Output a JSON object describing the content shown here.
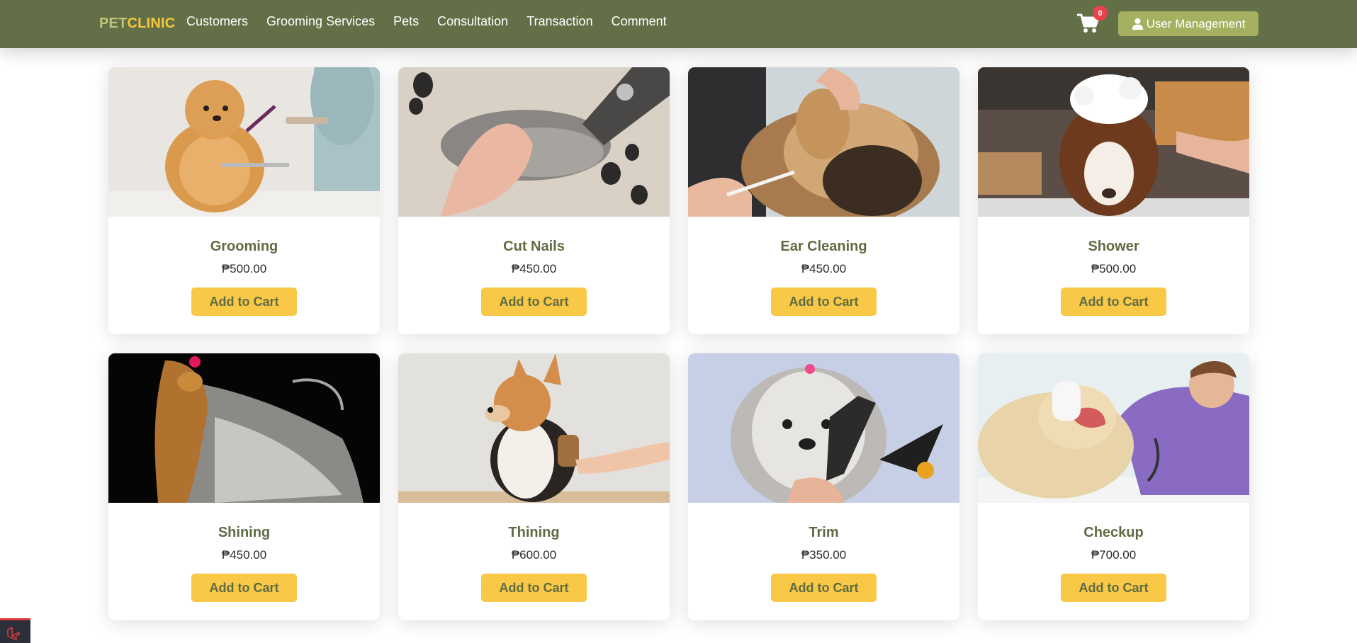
{
  "brand": {
    "part1": "PET",
    "part2": "CLINIC"
  },
  "nav": {
    "links": [
      "Customers",
      "Grooming Services",
      "Pets",
      "Consultation",
      "Transaction",
      "Comment"
    ]
  },
  "cart": {
    "count": "0",
    "icon": "shopping-cart-icon"
  },
  "user_button": {
    "label": "User Management",
    "icon": "user-icon"
  },
  "services": [
    {
      "title": "Grooming",
      "price": "₱500.00",
      "button": "Add to Cart",
      "image": "pomeranian-grooming"
    },
    {
      "title": "Cut Nails",
      "price": "₱450.00",
      "button": "Add to Cart",
      "image": "paw-nail-clipping"
    },
    {
      "title": "Ear Cleaning",
      "price": "₱450.00",
      "button": "Add to Cart",
      "image": "yorkie-ear-cleaning"
    },
    {
      "title": "Shower",
      "price": "₱500.00",
      "button": "Add to Cart",
      "image": "spaniel-shampoo"
    },
    {
      "title": "Shining",
      "price": "₱450.00",
      "button": "Add to Cart",
      "image": "yorkshire-long-coat"
    },
    {
      "title": "Thining",
      "price": "₱600.00",
      "button": "Add to Cart",
      "image": "corgi-brushing"
    },
    {
      "title": "Trim",
      "price": "₱350.00",
      "button": "Add to Cart",
      "image": "shih-tzu-trim"
    },
    {
      "title": "Checkup",
      "price": "₱700.00",
      "button": "Add to Cart",
      "image": "vet-checkup"
    }
  ],
  "colors": {
    "navbar": "#636f47",
    "accent_yellow": "#f8c846",
    "title_green": "#5f6c42",
    "user_button": "#a5b160",
    "badge_red": "#e8414b"
  }
}
